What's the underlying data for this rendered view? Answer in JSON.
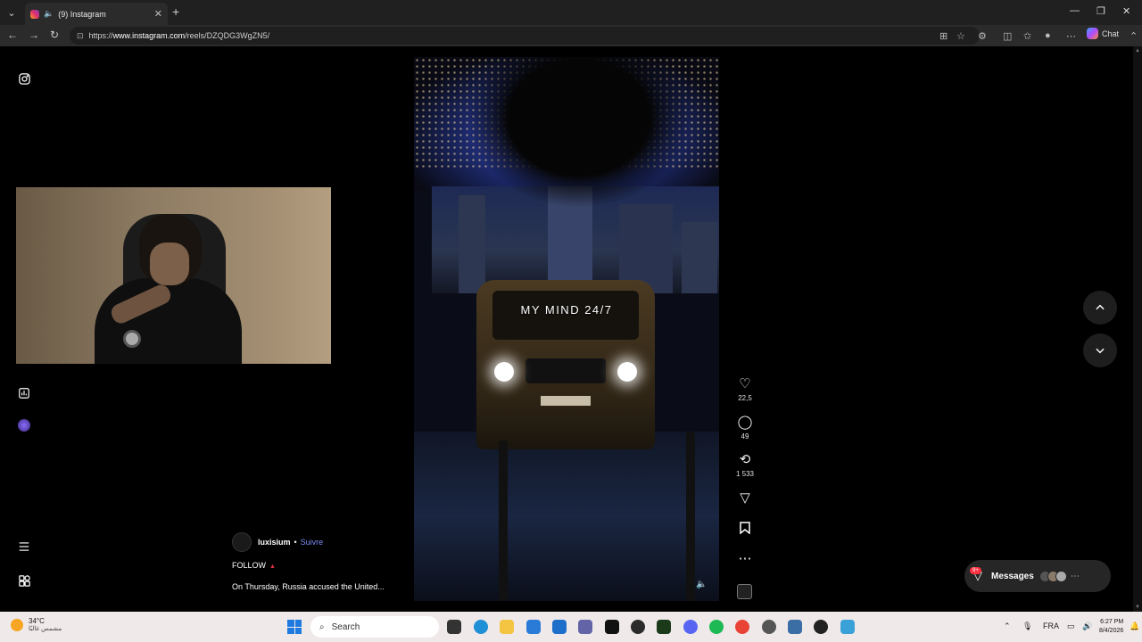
{
  "browser": {
    "tab_title": "(9) Instagram",
    "url_prefix": "https://",
    "url_host": "www.instagram.com",
    "url_path": "/reels/DZQDG3WgZN5/",
    "chat_label": "Chat"
  },
  "reel": {
    "overlay_text": "MY MIND 24/7",
    "likes": "22,5",
    "comments": "49",
    "reposts": "1 533"
  },
  "post": {
    "author": "luxisium",
    "separator": "•",
    "follow_label": "Suivre",
    "follow_caps": "FOLLOW",
    "description": "On Thursday, Russia accused the United..."
  },
  "messages": {
    "label": "Messages",
    "badge": "9+"
  },
  "taskbar": {
    "temperature": "34°C",
    "weather_desc": "مشمس غالبًا",
    "search_placeholder": "Search",
    "language": "FRA",
    "time": "6:27 PM",
    "date": "8/4/2026"
  },
  "icons": [
    "instagram-icon",
    "insights-icon",
    "profile-avatar",
    "menu-icon",
    "apps-icon",
    "heart-icon",
    "comment-icon",
    "repost-icon",
    "share-icon",
    "bookmark-icon",
    "more-icon",
    "sound-icon",
    "chevron-up-icon",
    "chevron-down-icon",
    "messages-icon"
  ],
  "colors": {
    "follow_link": "#7c8cf5",
    "badge": "#ff3040",
    "taskbar_bg": "#f0e9ea"
  }
}
